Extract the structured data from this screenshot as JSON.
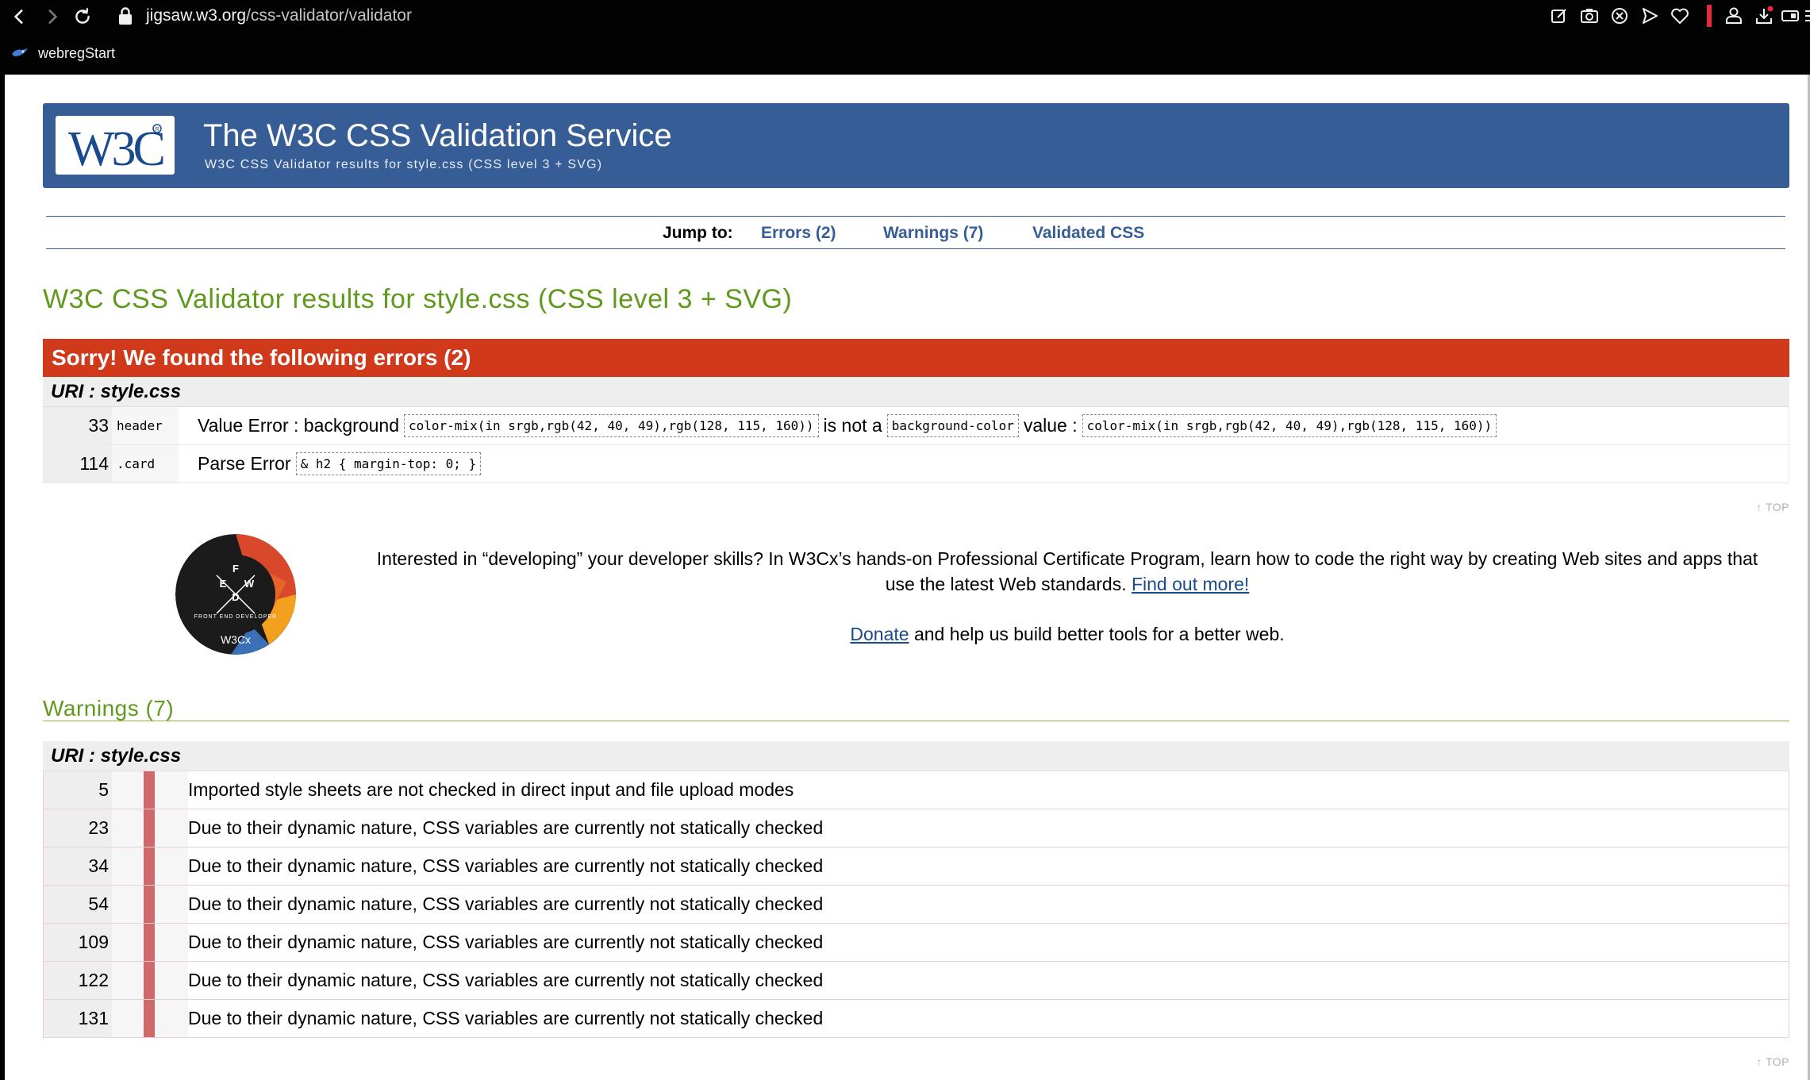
{
  "browser": {
    "url_host": "jigsaw.w3.org",
    "url_path": "/css-validator/validator",
    "bookmark_label": "webregStart"
  },
  "banner": {
    "title": "The W3C CSS Validation Service",
    "subtitle": "W3C CSS Validator results for style.css (CSS level 3 + SVG)",
    "logo_text": "W3C"
  },
  "jump": {
    "label": "Jump to:",
    "errors_link": "Errors (2)",
    "warnings_link": "Warnings (7)",
    "validated_link": "Validated CSS"
  },
  "results_title": "W3C CSS Validator results for style.css (CSS level 3 + SVG)",
  "errors": {
    "heading": "Sorry! We found the following errors (2)",
    "uri_label": "URI : style.css",
    "rows": [
      {
        "line": "33",
        "context": "header",
        "type": "Value Error",
        "parts": [
          ": background",
          "color-mix(in srgb,rgb(42, 40, 49),rgb(128, 115, 160))",
          "is not a",
          "background-color",
          "value :",
          "color-mix(in srgb,rgb(42, 40, 49),rgb(128, 115, 160))"
        ]
      },
      {
        "line": "114",
        "context": ".card",
        "type": "Parse Error",
        "parts": [
          "& h2 { margin-top: 0; }"
        ]
      }
    ],
    "top_link": "↑ TOP"
  },
  "promo": {
    "text_before": "Interested in “developing” your developer skills? In W3Cx’s hands-on Professional Certificate Program, learn how to code the right way by creating Web sites and apps that use the latest Web standards.",
    "find_out": "Find out more!",
    "donate_link": "Donate",
    "donate_rest": "and help us build better tools for a better web.",
    "badge_letters": [
      "F",
      "E",
      "W",
      "D"
    ],
    "badge_caption": "FRONT END DEVELOPER",
    "badge_brand": "W3Cx"
  },
  "warnings": {
    "heading": "Warnings (7)",
    "uri_label": "URI : style.css",
    "rows": [
      {
        "line": "5",
        "message": "Imported style sheets are not checked in direct input and file upload modes"
      },
      {
        "line": "23",
        "message": "Due to their dynamic nature, CSS variables are currently not statically checked"
      },
      {
        "line": "34",
        "message": "Due to their dynamic nature, CSS variables are currently not statically checked"
      },
      {
        "line": "54",
        "message": "Due to their dynamic nature, CSS variables are currently not statically checked"
      },
      {
        "line": "109",
        "message": "Due to their dynamic nature, CSS variables are currently not statically checked"
      },
      {
        "line": "122",
        "message": "Due to their dynamic nature, CSS variables are currently not statically checked"
      },
      {
        "line": "131",
        "message": "Due to their dynamic nature, CSS variables are currently not statically checked"
      }
    ],
    "top_link": "↑ TOP"
  },
  "colors": {
    "banner": "#365d95",
    "error_head": "#d1391b",
    "title_green": "#5f9a1d",
    "warning_marker": "#d06a6a",
    "link": "#1a4a8e"
  }
}
